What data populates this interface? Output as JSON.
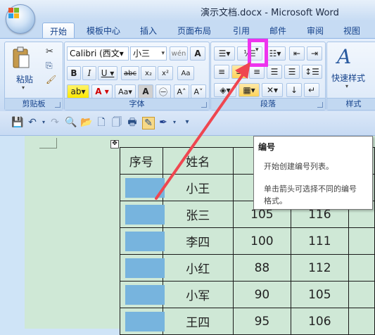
{
  "window": {
    "title": "演示文档.docx - Microsoft Word"
  },
  "tabs": [
    "开始",
    "模板中心",
    "插入",
    "页面布局",
    "引用",
    "邮件",
    "审阅",
    "视图"
  ],
  "clipboard": {
    "paste_label": "粘贴",
    "group_label": "剪贴板"
  },
  "font": {
    "name": "Calibri (西文▾",
    "size": "小三",
    "group_label": "字体"
  },
  "paragraph": {
    "group_label": "段落"
  },
  "styles": {
    "quick_styles_label": "快速样式",
    "group_label": "样式"
  },
  "table": {
    "headers": [
      "序号",
      "姓名",
      "",
      "",
      ""
    ],
    "rows": [
      {
        "num": "",
        "name": "小王",
        "v1": "",
        "v2": ""
      },
      {
        "num": "",
        "name": "张三",
        "v1": "105",
        "v2": "116"
      },
      {
        "num": "",
        "name": "李四",
        "v1": "100",
        "v2": "111"
      },
      {
        "num": "",
        "name": "小红",
        "v1": "88",
        "v2": "112"
      },
      {
        "num": "",
        "name": "小军",
        "v1": "90",
        "v2": "105"
      },
      {
        "num": "",
        "name": "王四",
        "v1": "95",
        "v2": "106"
      }
    ]
  },
  "tooltip": {
    "title": "编号",
    "line1": "开始创建编号列表。",
    "line2": "单击箭头可选择不同的编号",
    "line3": "格式。"
  },
  "colors": {
    "annotation_box": "#ee33ee",
    "annotation_arrow": "#ef4650",
    "cell_fill": "#77b4de",
    "page_bg": "#cfe8d6"
  }
}
